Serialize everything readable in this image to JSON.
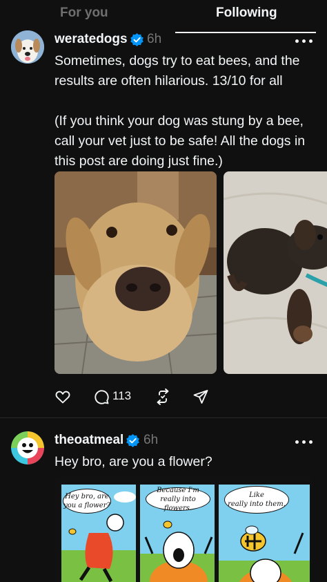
{
  "tabs": {
    "for_you": "For you",
    "following": "Following"
  },
  "posts": [
    {
      "username": "weratedogs",
      "time": "6h",
      "text_line1": "Sometimes, dogs try to eat bees, and the",
      "text_line2": "results are often hilarious. 13/10 for all",
      "text_line3": "(If you think your dog was stung by a bee,",
      "text_line4": "call your vet just to be safe! All the dogs in",
      "text_line5": "this post are doing just fine.)",
      "reply_count": "113",
      "accent": "#0095f6"
    },
    {
      "username": "theoatmeal",
      "time": "6h",
      "text": "Hey bro, are you a flower?",
      "comic": {
        "panel1_bubble": "Hey bro, are you a flower?",
        "panel2_bubble": "Because I'm really into flowers.",
        "panel3_bubble_line1": "Like",
        "panel3_bubble_line2": "really into them."
      }
    }
  ]
}
